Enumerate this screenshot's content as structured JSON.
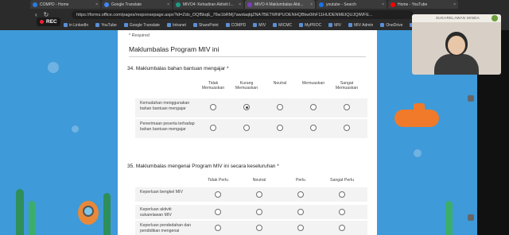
{
  "browser": {
    "tabs": [
      {
        "label": "COMPD - Home",
        "color": "#2a7be4"
      },
      {
        "label": "Google Translate",
        "color": "#4285f4"
      },
      {
        "label": "MIVO4: Kehadiran Aktiviti I...",
        "color": "#1b9c85"
      },
      {
        "label": "MIVO 4 Maklumbalas Akti...",
        "color": "#7a3fbf"
      },
      {
        "label": "youtube - Search",
        "color": "#1a73e8"
      },
      {
        "label": "Home - YouTube",
        "color": "#ff0000"
      }
    ],
    "url": "https://forms.office.com/pages/responsepage.aspx?id=Zdo_OQf5kqE_76w1bRMj7awdaqbjZNA7BETWNPUOENHQBkw0thF11HUDENMEIQUJQlWFE...",
    "bookmarks": [
      "in LinkedIn",
      "YouTube",
      "Google Translate",
      "Intranet",
      "SharePoint",
      "COMPD",
      "MIV",
      "MICMC",
      "MyPROC",
      "MIV",
      "MIV Admin",
      "OneDrive",
      "MIV Collateral Reque..."
    ]
  },
  "recording": {
    "label": "REC"
  },
  "form": {
    "required_note": "* Required",
    "section_title": "Maklumbalas Program MIV ini",
    "q34": {
      "title": "34. Maklumbalas bahan bantuan mengajar *",
      "columns": [
        "Tidak Memuaskan",
        "Kurang Memuaskan",
        "Neutral",
        "Memuaskan",
        "Sangat Memuaskan"
      ],
      "rows": [
        {
          "label": "Kemudahan menggunakan bahan bantuan mengajar",
          "selected": 1
        },
        {
          "label": "Penerimaan peserta terhadap bahan bantuan mengajar",
          "selected": -1
        }
      ]
    },
    "q35": {
      "title": "35. Maklumbalas mengenai Program MIV ini secara keseluruhan *",
      "columns": [
        "Tidak Perlu",
        "Neutral",
        "Perlu",
        "Sangat Perlu"
      ],
      "rows": [
        {
          "label": "Keperluan bengkel MIV",
          "selected": -1
        },
        {
          "label": "Keperluan aktiviti sukarelawan MIV",
          "selected": -1
        },
        {
          "label": "Keperluan pendedahan dan pendidikan mengenai",
          "selected": -1
        }
      ]
    }
  },
  "webcam": {
    "name": "SUKARELAWAN MINDA"
  }
}
